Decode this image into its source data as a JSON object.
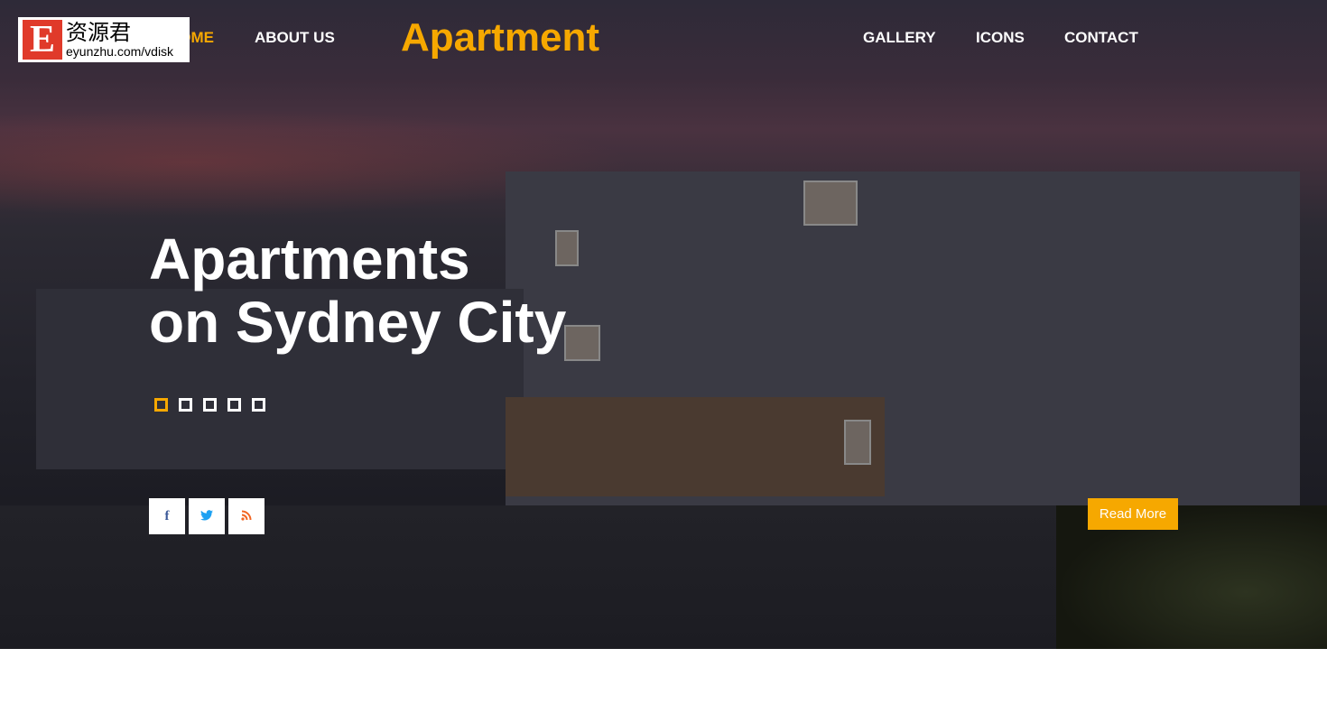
{
  "watermark": {
    "letter": "E",
    "chinese": "资源君",
    "url": "eyunzhu.com/vdisk"
  },
  "nav": {
    "home": "HOME",
    "about": "ABOUT US",
    "brand": "Apartment",
    "gallery": "GALLERY",
    "icons": "ICONS",
    "contact": "CONTACT"
  },
  "hero": {
    "title_line1": "Apartments",
    "title_line2": "on Sydney City",
    "slides": 5,
    "active_slide": 1,
    "read_more": "Read More"
  },
  "social": [
    {
      "icon": "facebook-icon",
      "glyph": "f",
      "color": "#3b5998"
    },
    {
      "icon": "twitter-icon",
      "glyph": "🐦",
      "color": "#1da1f2"
    },
    {
      "icon": "rss-icon",
      "glyph": "◝",
      "color": "#f26522"
    }
  ],
  "colors": {
    "accent": "#f6a800"
  }
}
